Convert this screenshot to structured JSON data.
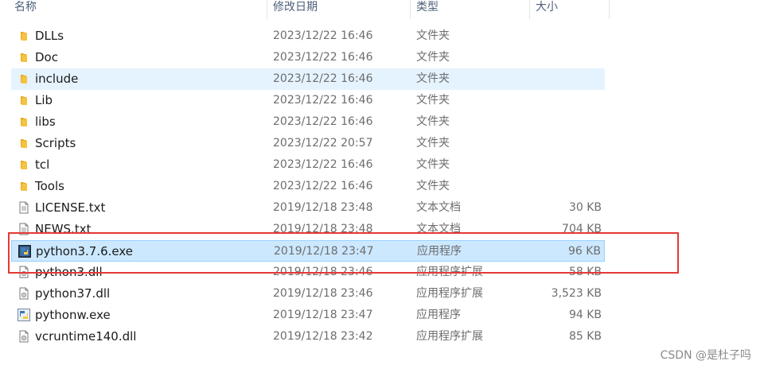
{
  "columns": {
    "name": "名称",
    "modified": "修改日期",
    "type": "类型",
    "size": "大小"
  },
  "files": [
    {
      "name": "DLLs",
      "modified": "2023/12/22 16:46",
      "type": "文件夹",
      "size": "",
      "icon": "folder-icon",
      "state": ""
    },
    {
      "name": "Doc",
      "modified": "2023/12/22 16:46",
      "type": "文件夹",
      "size": "",
      "icon": "folder-icon",
      "state": ""
    },
    {
      "name": "include",
      "modified": "2023/12/22 16:46",
      "type": "文件夹",
      "size": "",
      "icon": "folder-icon",
      "state": "hover"
    },
    {
      "name": "Lib",
      "modified": "2023/12/22 16:46",
      "type": "文件夹",
      "size": "",
      "icon": "folder-icon",
      "state": ""
    },
    {
      "name": "libs",
      "modified": "2023/12/22 16:46",
      "type": "文件夹",
      "size": "",
      "icon": "folder-icon",
      "state": ""
    },
    {
      "name": "Scripts",
      "modified": "2023/12/22 20:57",
      "type": "文件夹",
      "size": "",
      "icon": "folder-icon",
      "state": ""
    },
    {
      "name": "tcl",
      "modified": "2023/12/22 16:46",
      "type": "文件夹",
      "size": "",
      "icon": "folder-icon",
      "state": ""
    },
    {
      "name": "Tools",
      "modified": "2023/12/22 16:46",
      "type": "文件夹",
      "size": "",
      "icon": "folder-icon",
      "state": ""
    },
    {
      "name": "LICENSE.txt",
      "modified": "2019/12/18 23:48",
      "type": "文本文档",
      "size": "30 KB",
      "icon": "text-document-icon",
      "state": ""
    },
    {
      "name": "NEWS.txt",
      "modified": "2019/12/18 23:48",
      "type": "文本文档",
      "size": "704 KB",
      "icon": "text-document-icon",
      "state": ""
    },
    {
      "name": "python3.7.6.exe",
      "modified": "2019/12/18 23:47",
      "type": "应用程序",
      "size": "96 KB",
      "icon": "python-installer-icon",
      "state": "selected"
    },
    {
      "name": "python3.dll",
      "modified": "2019/12/18 23:46",
      "type": "应用程序扩展",
      "size": "58 KB",
      "icon": "dll-file-icon",
      "state": ""
    },
    {
      "name": "python37.dll",
      "modified": "2019/12/18 23:46",
      "type": "应用程序扩展",
      "size": "3,523 KB",
      "icon": "dll-file-icon",
      "state": ""
    },
    {
      "name": "pythonw.exe",
      "modified": "2019/12/18 23:47",
      "type": "应用程序",
      "size": "94 KB",
      "icon": "python-exe-icon",
      "state": ""
    },
    {
      "name": "vcruntime140.dll",
      "modified": "2019/12/18 23:42",
      "type": "应用程序扩展",
      "size": "85 KB",
      "icon": "dll-file-icon",
      "state": ""
    }
  ],
  "watermark": "CSDN @是杜子吗",
  "colors": {
    "selection": "#cce8ff",
    "hover": "#e5f3ff",
    "highlight_box": "#e53935",
    "folder": "#f5c342"
  }
}
